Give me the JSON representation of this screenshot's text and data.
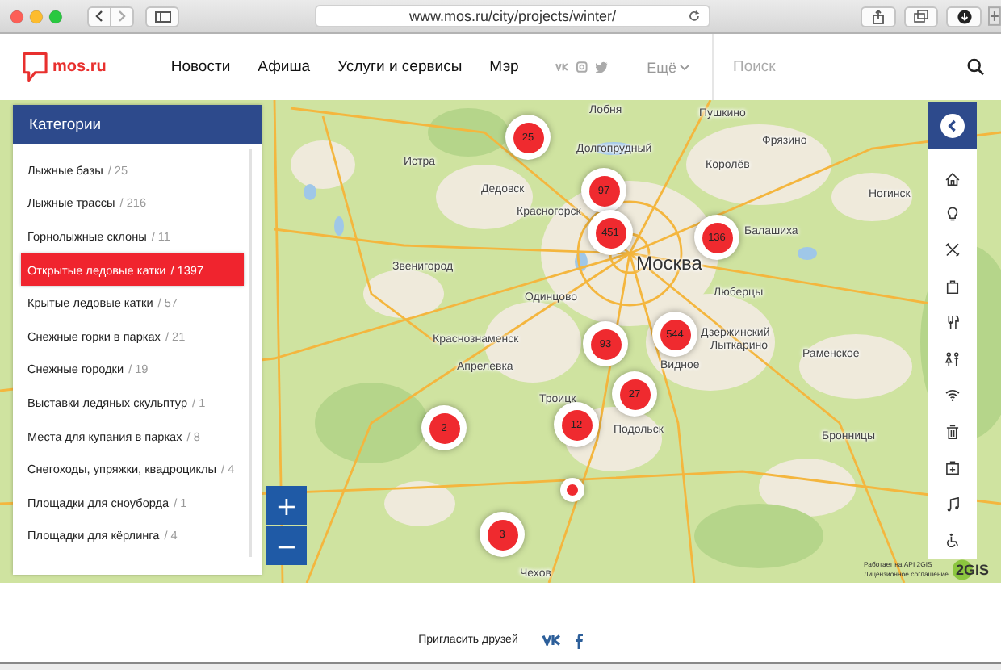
{
  "browser": {
    "url": "www.mos.ru/city/projects/winter/"
  },
  "header": {
    "logo_text": "mos.ru",
    "nav": [
      "Новости",
      "Афиша",
      "Услуги и сервисы",
      "Мэр"
    ],
    "more": "Ещё",
    "search": {
      "placeholder": "Поиск"
    }
  },
  "sidebar": {
    "title": "Категории",
    "items": [
      {
        "label": "Лыжные базы",
        "count": "/ 25",
        "selected": false
      },
      {
        "label": "Лыжные трассы",
        "count": "/ 216",
        "selected": false
      },
      {
        "label": "Горнолыжные склоны",
        "count": "/ 11",
        "selected": false
      },
      {
        "label": "Открытые ледовые катки",
        "count": "/ 1397",
        "selected": true
      },
      {
        "label": "Крытые ледовые катки",
        "count": "/ 57",
        "selected": false
      },
      {
        "label": "Снежные горки в парках",
        "count": "/ 21",
        "selected": false
      },
      {
        "label": "Снежные городки",
        "count": "/ 19",
        "selected": false
      },
      {
        "label": "Выставки ледяных скульптур",
        "count": "/ 1",
        "selected": false
      },
      {
        "label": "Места для купания в парках",
        "count": "/ 8",
        "selected": false
      },
      {
        "label": "Снегоходы, упряжки, квадроциклы",
        "count": "/ 4",
        "selected": false
      },
      {
        "label": "Площадки для сноуборда",
        "count": "/ 1",
        "selected": false
      },
      {
        "label": "Площадки для кёрлинга",
        "count": "/ 4",
        "selected": false
      }
    ]
  },
  "map": {
    "labels": [
      "Лобня",
      "Пушкино",
      "Фрязино",
      "Долгопрудный",
      "Королёв",
      "Истра",
      "Дедовск",
      "Ногинск",
      "Красногорск",
      "Балашиха",
      "Москва",
      "Звенигород",
      "Люберцы",
      "Одинцово",
      "Краснознаменск",
      "Дзержинский",
      "Лыткарино",
      "Раменское",
      "Апрелевка",
      "Видное",
      "Троицк",
      "Подольск",
      "Бронницы",
      "Чехов"
    ],
    "markers": [
      {
        "kind": "cluster",
        "count": "25"
      },
      {
        "kind": "cluster",
        "count": "97"
      },
      {
        "kind": "cluster",
        "count": "451"
      },
      {
        "kind": "cluster",
        "count": "136"
      },
      {
        "kind": "cluster",
        "count": "93"
      },
      {
        "kind": "cluster",
        "count": "544"
      },
      {
        "kind": "cluster",
        "count": "27"
      },
      {
        "kind": "cluster",
        "count": "12"
      },
      {
        "kind": "cluster",
        "count": "2"
      },
      {
        "kind": "point"
      },
      {
        "kind": "cluster",
        "count": "3"
      }
    ],
    "zoom": {
      "in": "+",
      "out": "−"
    },
    "attribution": [
      "Работает на API 2GIS",
      "Лицензионное соглашение"
    ],
    "provider_logo": "2GIS"
  },
  "footer": {
    "invite": "Пригласить друзей"
  }
}
